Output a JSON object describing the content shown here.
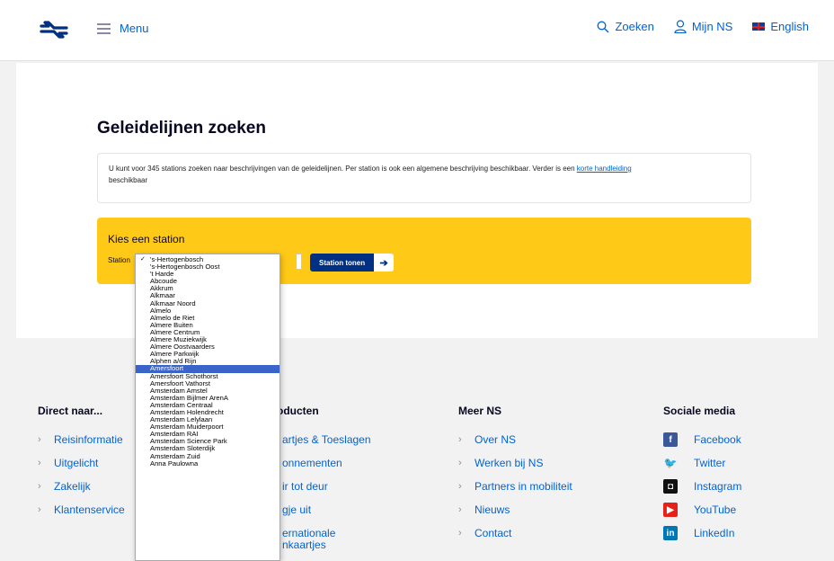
{
  "header": {
    "menu_label": "Menu",
    "search_label": "Zoeken",
    "account_label": "Mijn NS",
    "language_label": "English"
  },
  "main": {
    "title": "Geleidelijnen zoeken",
    "intro_text": "U kunt voor 345 stations zoeken naar beschrijvingen van de geleidelijnen. Per station is ook een algemene beschrijving beschikbaar. Verder is een ",
    "intro_link": "korte handleiding",
    "intro_tail": "beschikbaar",
    "choose_heading": "Kies een station",
    "station_label": "Station",
    "show_button": "Station tonen",
    "show_button_arrow": "➔"
  },
  "dropdown": {
    "selected_index": 0,
    "highlighted_index": 20,
    "options": [
      "'s-Hertogenbosch",
      "'s-Hertogenbosch Oost",
      "'t Harde",
      "Abcoude",
      "Akkrum",
      "Alkmaar",
      "Alkmaar Noord",
      "Almelo",
      "Almelo de Riet",
      "Almere Buiten",
      "Almere Centrum",
      "Almere Muziekwijk",
      "Almere Oostvaarders",
      "Almere Parkwijk",
      "Alphen a/d Rijn",
      "Amersfoort",
      "Amersfoort Schothorst",
      "Amersfoort Vathorst",
      "Amsterdam Amstel",
      "Amsterdam Bijlmer ArenA",
      "Amsterdam Centraal",
      "Amsterdam Holendrecht",
      "Amsterdam Lelylaan",
      "Amsterdam Muiderpoort",
      "Amsterdam RAI",
      "Amsterdam Science Park",
      "Amsterdam Sloterdijk",
      "Amsterdam Zuid",
      "Anna Paulowna"
    ]
  },
  "footer": {
    "col1": {
      "heading": "Direct naar...",
      "items": [
        "Reisinformatie",
        "Uitgelicht",
        "Zakelijk",
        "Klantenservice"
      ]
    },
    "col2": {
      "heading": "producten",
      "items": [
        "artjes & Toeslagen",
        "onnementen",
        "ir tot deur",
        "gje uit",
        "ernationale",
        "nkaartjes"
      ]
    },
    "col3": {
      "heading": "Meer NS",
      "items": [
        "Over NS",
        "Werken bij NS",
        "Partners in mobiliteit",
        "Nieuws",
        "Contact"
      ]
    },
    "col4": {
      "heading": "Sociale media",
      "items": [
        "Facebook",
        "Twitter",
        "Instagram",
        "YouTube",
        "LinkedIn"
      ],
      "icons": [
        "facebook-icon",
        "twitter-icon",
        "instagram-icon",
        "youtube-icon",
        "linkedin-icon"
      ],
      "icon_glyphs": [
        "f",
        "🐦",
        "◘",
        "▶",
        "in"
      ],
      "icon_colors": [
        "#3b5998",
        "#55acee",
        "#111111",
        "#e62117",
        "#0077b5"
      ]
    },
    "chevron": "›"
  },
  "colors": {
    "brand_blue": "#003082",
    "link_blue": "#0063d3",
    "ns_yellow": "#ffc917"
  }
}
